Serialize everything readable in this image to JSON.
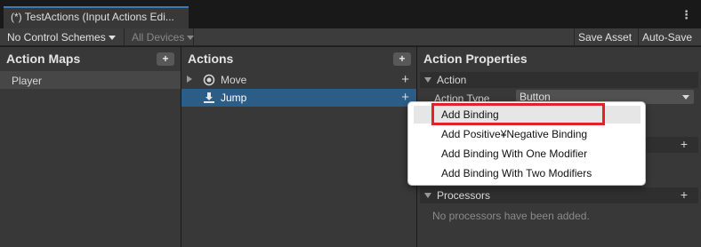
{
  "window": {
    "tab_title": "(*) TestActions (Input Actions Edi...",
    "more_icon": "kebab-menu-icon"
  },
  "toolbar": {
    "control_schemes": "No Control Schemes",
    "devices": "All Devices",
    "save_asset": "Save Asset",
    "auto_save": "Auto-Save"
  },
  "action_maps": {
    "header": "Action Maps",
    "add_label": "+",
    "items": [
      {
        "label": "Player"
      }
    ]
  },
  "actions": {
    "header": "Actions",
    "add_label": "+",
    "items": [
      {
        "label": "Move",
        "icon": "radio-target-icon",
        "row_add": "+"
      },
      {
        "label": "Jump",
        "icon": "button-press-icon",
        "row_add": "+"
      }
    ]
  },
  "properties": {
    "header": "Action Properties",
    "action_section": "Action",
    "action_type_label": "Action Type",
    "action_type_value": "Button",
    "section_add": "+",
    "processors_section": "Processors",
    "processors_add": "+",
    "processors_empty": "No processors have been added."
  },
  "context_menu": {
    "items": [
      {
        "label": "Add Binding"
      },
      {
        "label": "Add Positive¥Negative Binding"
      },
      {
        "label": "Add Binding With One Modifier"
      },
      {
        "label": "Add Binding With Two Modifiers"
      }
    ]
  },
  "colors": {
    "selection": "#2c5d87",
    "annotation": "#e3202d",
    "tab_accent": "#3a79bb"
  }
}
